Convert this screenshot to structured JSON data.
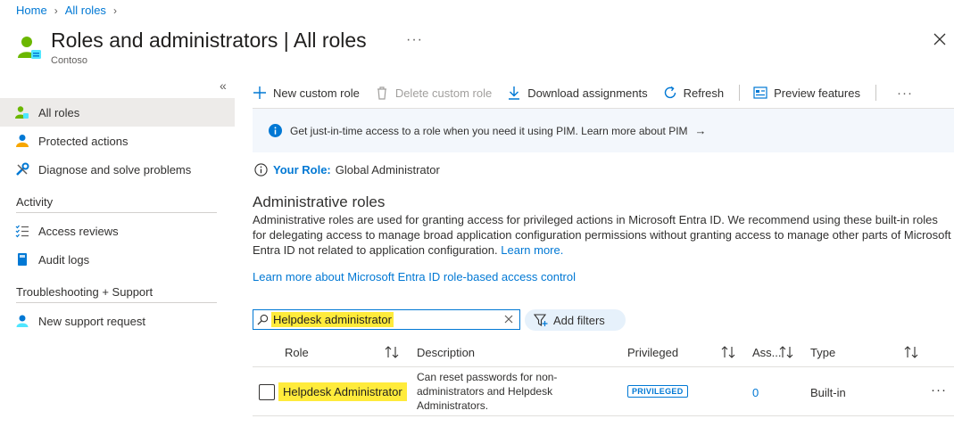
{
  "breadcrumb": [
    "Home",
    "All roles"
  ],
  "header": {
    "title": "Roles and administrators | All roles",
    "subtitle": "Contoso",
    "more": "···"
  },
  "sidebar": {
    "collapse": "«",
    "items": [
      {
        "label": "All roles",
        "icon": "roles-icon",
        "active": true
      },
      {
        "label": "Protected actions",
        "icon": "person-icon"
      },
      {
        "label": "Diagnose and solve problems",
        "icon": "wrench-icon"
      }
    ],
    "activity": {
      "title": "Activity",
      "items": [
        {
          "label": "Access reviews",
          "icon": "checklist-icon"
        },
        {
          "label": "Audit logs",
          "icon": "book-icon"
        }
      ]
    },
    "support": {
      "title": "Troubleshooting + Support",
      "items": [
        {
          "label": "New support request",
          "icon": "support-icon"
        }
      ]
    }
  },
  "toolbar": {
    "new_role": "New custom role",
    "delete_role": "Delete custom role",
    "download": "Download assignments",
    "refresh": "Refresh",
    "preview": "Preview features",
    "more": "···"
  },
  "info": {
    "text": "Get just-in-time access to a role when you need it using PIM. Learn more about PIM",
    "arrow": "→"
  },
  "your_role": {
    "label": "Your Role:",
    "value": "Global Administrator"
  },
  "admin_roles": {
    "heading": "Administrative roles",
    "description": "Administrative roles are used for granting access for privileged actions in Microsoft Entra ID. We recommend using these built-in roles for delegating access to manage broad application configuration permissions without granting access to manage other parts of Microsoft Entra ID not related to application configuration.",
    "learn_more": "Learn more.",
    "rbac_link": "Learn more about Microsoft Entra ID role-based access control"
  },
  "search": {
    "value": "Helpdesk administrator",
    "add_filters": "Add filters"
  },
  "grid": {
    "columns": [
      "Role",
      "Description",
      "Privileged",
      "Ass...",
      "Type"
    ],
    "rows": [
      {
        "role": "Helpdesk Administrator",
        "description": "Can reset passwords for non-administrators and Helpdesk Administrators.",
        "privileged": "PRIVILEGED",
        "assignments": "0",
        "type": "Built-in",
        "more": "···"
      }
    ]
  },
  "colors": {
    "accent": "#0078d4",
    "highlight": "#ffeb3b",
    "info_bg": "#f3f7fc",
    "active_nav": "#edebe9"
  }
}
